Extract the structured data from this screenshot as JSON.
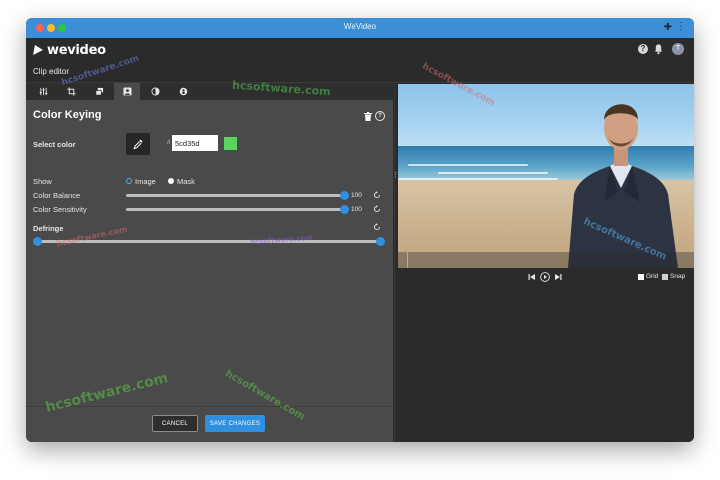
{
  "window": {
    "title": "WeVideo"
  },
  "app": {
    "logo_text": "wevideo",
    "help_icon": "help-circle-icon",
    "bell_icon": "bell-icon",
    "avatar_initial": "T"
  },
  "subheader": {
    "title": "Clip editor"
  },
  "tabs": [
    {
      "icon": "sliders-icon",
      "active": false
    },
    {
      "icon": "crop-icon",
      "active": false
    },
    {
      "icon": "layers-icon",
      "active": false
    },
    {
      "icon": "person-portrait-icon",
      "active": true
    },
    {
      "icon": "contrast-icon",
      "active": false
    },
    {
      "icon": "mask-icon",
      "active": false
    }
  ],
  "color_keying": {
    "title": "Color Keying",
    "select_color_label": "Select color",
    "hash": "#",
    "hex_value": "5cd35d",
    "swatch_color": "#5cd35d",
    "show_label": "Show",
    "show_options": [
      "Image",
      "Mask"
    ],
    "show_selected": "Image",
    "color_balance_label": "Color Balance",
    "color_balance_value": "100",
    "color_balance_fraction": 1.0,
    "color_sensitivity_label": "Color Sensitivity",
    "color_sensitivity_value": "100",
    "color_sensitivity_fraction": 1.0,
    "defringe_label": "Defringe"
  },
  "footer": {
    "cancel": "CANCEL",
    "save": "SAVE CHANGES"
  },
  "preview_controls": {
    "grid_label": "Grid",
    "snap_label": "Snap"
  },
  "watermark": {
    "text": "hcsoftware.com"
  },
  "colors": {
    "accent": "#2f8fe0",
    "titlebar": "#3b8fd6",
    "panel": "#4a4a4a",
    "app_bg": "#2b2b2b"
  }
}
